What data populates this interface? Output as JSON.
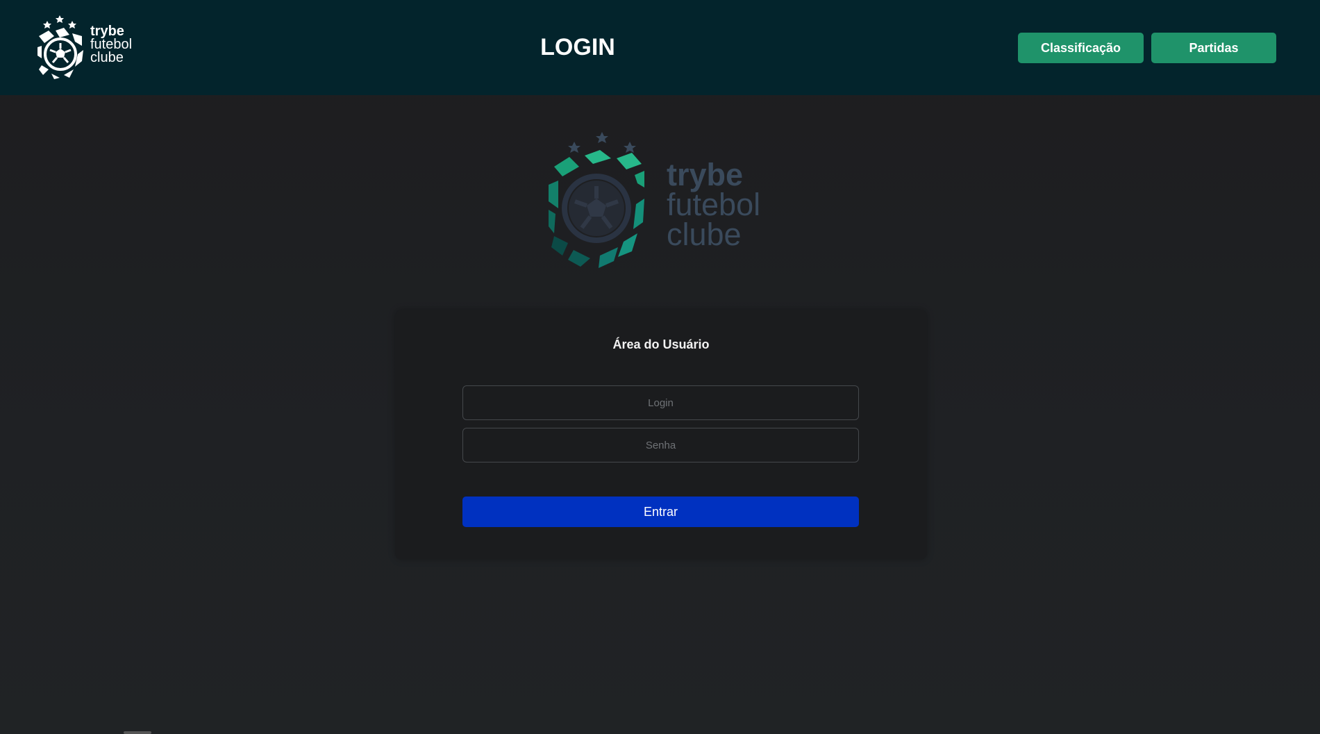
{
  "header": {
    "logo": {
      "line1": "trybe",
      "line2": "futebol",
      "line3": "clube",
      "icon": "soccer-shield-icon"
    },
    "title": "LOGIN",
    "nav": [
      {
        "label": "Classificação"
      },
      {
        "label": "Partidas"
      }
    ]
  },
  "main_logo": {
    "line1": "trybe",
    "line2": "futebol",
    "line3": "clube",
    "icon": "soccer-shield-icon"
  },
  "login_card": {
    "title": "Área do Usuário",
    "login_placeholder": "Login",
    "password_placeholder": "Senha",
    "submit_label": "Entrar"
  },
  "colors": {
    "header_bg": "#03242c",
    "nav_button": "#1f936a",
    "submit_button": "#0031c0",
    "card_bg": "#1b1c1e"
  }
}
